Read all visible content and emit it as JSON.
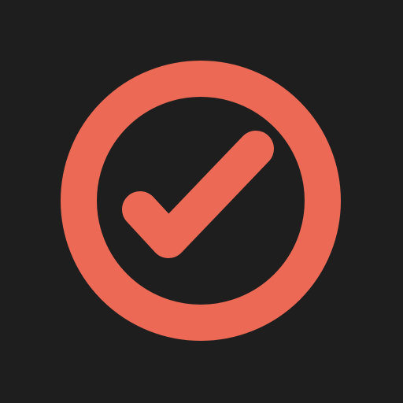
{
  "icon": {
    "name": "check-circle-icon",
    "foreground": "#ec6a55",
    "background": "#1f1e1e"
  }
}
